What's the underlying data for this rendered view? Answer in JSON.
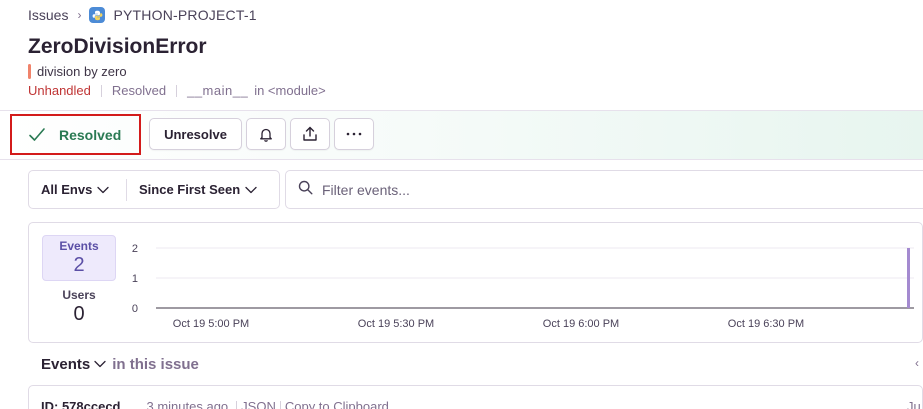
{
  "breadcrumb": {
    "issues": "Issues",
    "separator": "›",
    "project": "PYTHON-PROJECT-1",
    "project_icon": "python-icon"
  },
  "issue": {
    "title": "ZeroDivisionError",
    "message": "division by zero",
    "handled": "Unhandled",
    "status": "Resolved",
    "culprit_fn": "__main__",
    "culprit_module": "in <module>"
  },
  "actions": {
    "resolved_label": "Resolved",
    "unresolve_label": "Unresolve",
    "icons": [
      "bell-icon",
      "share-icon",
      "ellipsis-icon"
    ],
    "more_label": "···"
  },
  "filters": {
    "environment": "All Envs",
    "time_range": "Since First Seen",
    "search_placeholder": "Filter events..."
  },
  "stats": {
    "events_label": "Events",
    "events_count": "2",
    "users_label": "Users",
    "users_count": "0"
  },
  "chart_data": {
    "type": "bar",
    "y_ticks": [
      "2",
      "1",
      "0"
    ],
    "ylim": [
      0,
      2
    ],
    "x_tick_labels": [
      "Oct 19 5:00 PM",
      "Oct 19 5:30 PM",
      "Oct 19 6:00 PM",
      "Oct 19 6:30 PM"
    ],
    "series": [
      {
        "values": [
          2
        ]
      }
    ],
    "bar_color": "#a48ad0",
    "grid": true
  },
  "events_section": {
    "heading": "Events",
    "subheading": "in this issue",
    "nav_arrow": "‹"
  },
  "event": {
    "id": "ID: 578ccecd",
    "time": "3 minutes ago",
    "json": "JSON",
    "copy": "Copy to Clipboard",
    "right_date": "Ju"
  }
}
